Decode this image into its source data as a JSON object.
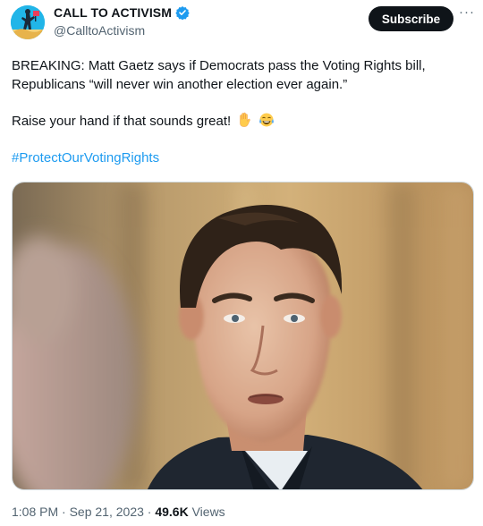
{
  "author": {
    "name": "CALL TO ACTIVISM",
    "handle": "@CalltoActivism",
    "verified": true,
    "avatar_icon": "activist-silhouette-avatar"
  },
  "actions": {
    "subscribe_label": "Subscribe",
    "more_label": "···"
  },
  "tweet": {
    "line1": "BREAKING: Matt Gaetz says if Democrats pass the Voting Rights bill,",
    "line2": "Republicans “will never win another election ever again.”",
    "line3": "Raise your hand if that sounds great!",
    "hashtag": "#ProtectOurVotingRights",
    "emojis": [
      "raised-hand-emoji",
      "tears-of-joy-emoji"
    ]
  },
  "media": {
    "type": "photo",
    "subject": "man-portrait-photo"
  },
  "footer": {
    "time": "1:08 PM",
    "separator": " · ",
    "date": "Sep 21, 2023",
    "views_count": "49.6K",
    "views_label": " Views"
  },
  "colors": {
    "accent": "#1d9bf0",
    "text": "#0f1419",
    "secondary": "#536471",
    "subscribe_bg": "#0f1419"
  }
}
